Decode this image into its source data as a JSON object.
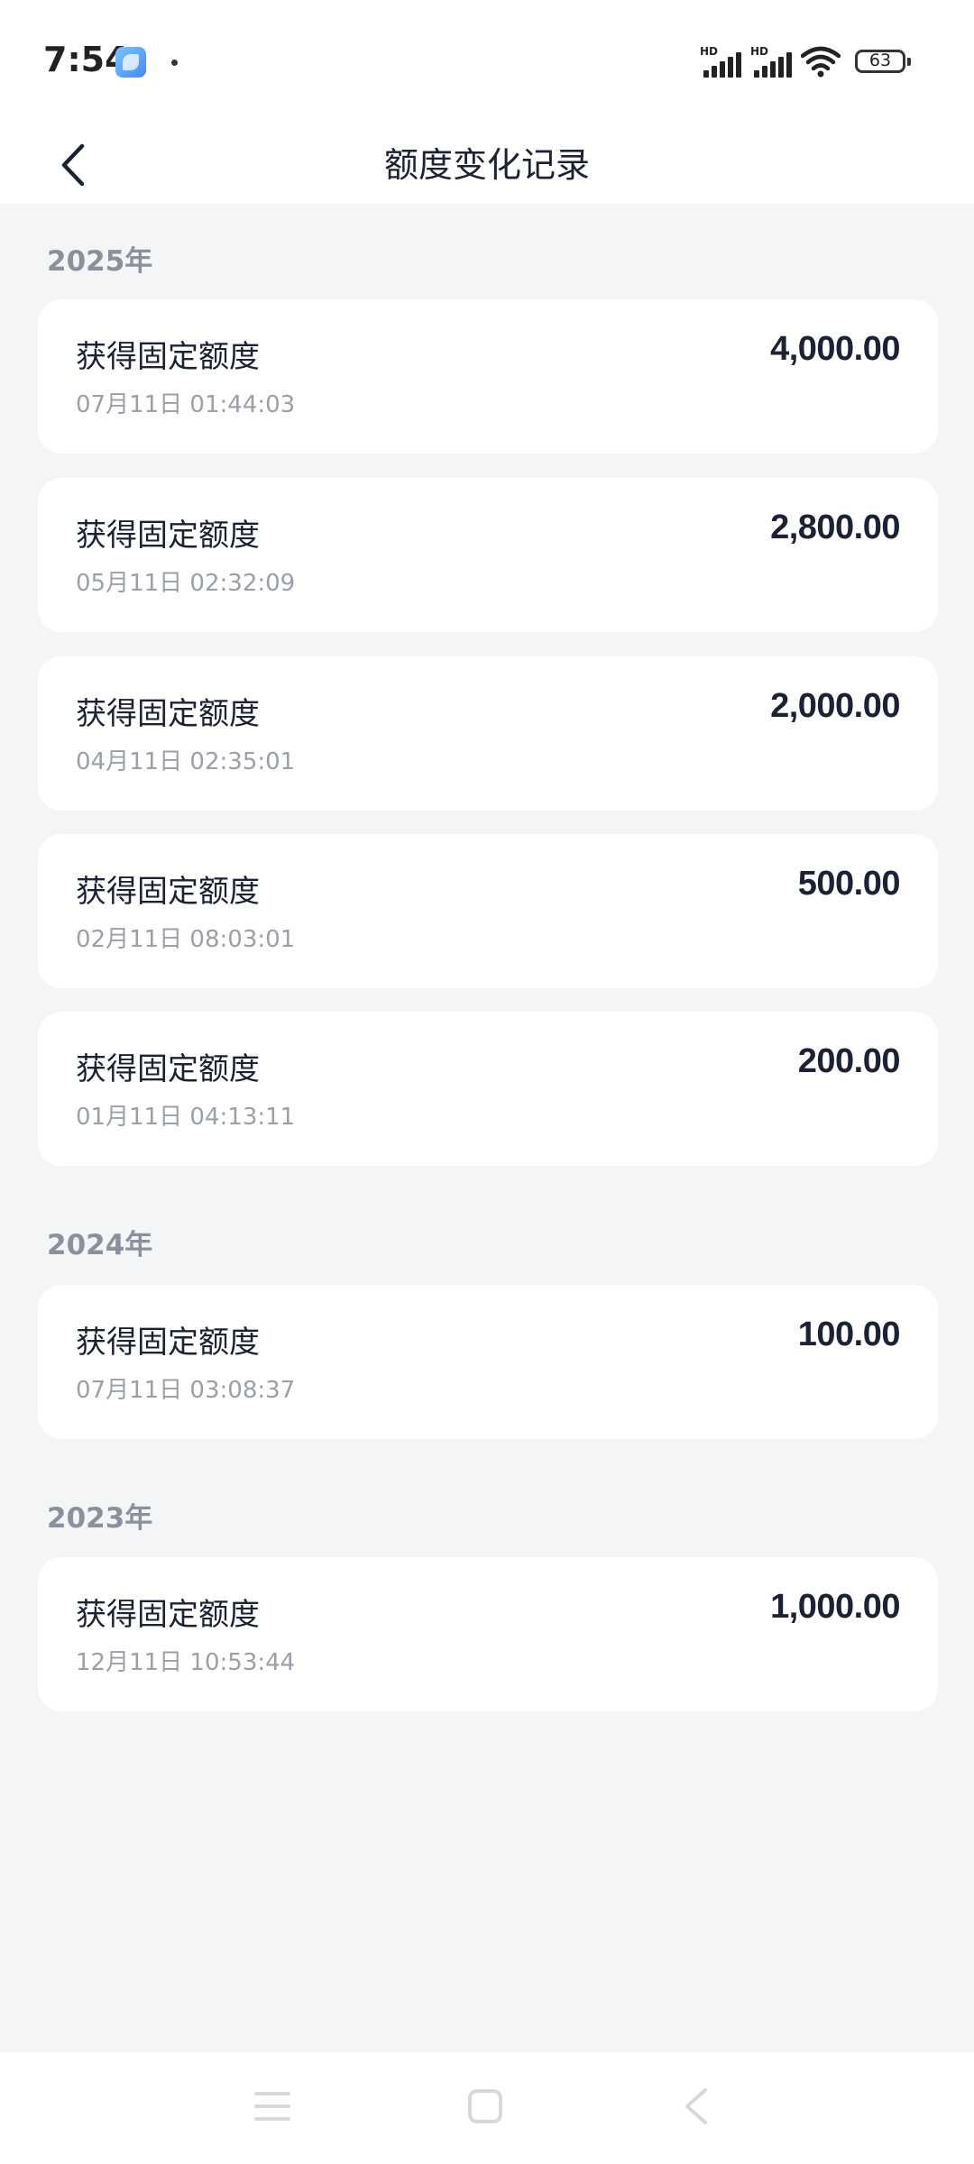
{
  "status_bar": {
    "time": "7:54",
    "network_labels": [
      "HD",
      "HD"
    ],
    "battery_level": "63",
    "icons": [
      "app-notification-icon",
      "signal-icon",
      "wifi-icon",
      "battery-icon"
    ]
  },
  "header": {
    "title": "额度变化记录",
    "back_icon": "chevron-left-icon"
  },
  "sections": [
    {
      "year": "2025年",
      "records": [
        {
          "title": "获得固定额度",
          "time": "07月11日 01:44:03",
          "amount": "4,000.00"
        },
        {
          "title": "获得固定额度",
          "time": "05月11日 02:32:09",
          "amount": "2,800.00"
        },
        {
          "title": "获得固定额度",
          "time": "04月11日 02:35:01",
          "amount": "2,000.00"
        },
        {
          "title": "获得固定额度",
          "time": "02月11日 08:03:01",
          "amount": "500.00"
        },
        {
          "title": "获得固定额度",
          "time": "01月11日 04:13:11",
          "amount": "200.00"
        }
      ]
    },
    {
      "year": "2024年",
      "records": [
        {
          "title": "获得固定额度",
          "time": "07月11日 03:08:37",
          "amount": "100.00"
        }
      ]
    },
    {
      "year": "2023年",
      "records": [
        {
          "title": "获得固定额度",
          "time": "12月11日 10:53:44",
          "amount": "1,000.00"
        }
      ]
    }
  ],
  "system_nav": {
    "icons": [
      "menu-icon",
      "home-icon",
      "back-icon"
    ]
  }
}
